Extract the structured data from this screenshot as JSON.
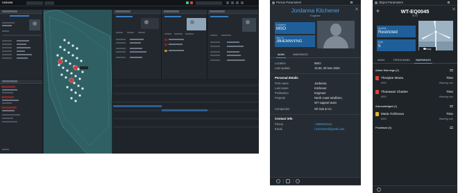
{
  "dashboard": {
    "logo": "VISION"
  },
  "person_panel": {
    "window_title": "Person Parameters",
    "name": "Jordanna Kitchener",
    "role": "Engineer",
    "location_label": "Location",
    "location_value": "MSO",
    "site_id_label": "Site ID",
    "site_id_value": "J8HENNVFNG",
    "tabs": [
      "MAIN",
      "WARNINGS"
    ],
    "active_tab": "MAIN",
    "status_rows": [
      {
        "k": "Location",
        "v": "MSO"
      },
      {
        "k": "Last update",
        "v": "15:30, 28 Nov 2020"
      }
    ],
    "personal_title": "Personal details",
    "personal_rows": [
      {
        "k": "First name",
        "v": "Jordanna"
      },
      {
        "k": "Last name",
        "v": "Kitchener"
      },
      {
        "k": "Profession",
        "v": "Engineer"
      },
      {
        "k": "Projects",
        "v": "North coast windfarm,"
      },
      {
        "k": "",
        "v": "WT support team"
      },
      {
        "k": "Companies",
        "v": "Oil Gas & Co."
      }
    ],
    "contact_title": "Contact info",
    "contact_rows": [
      {
        "k": "Phone",
        "v": "+3600023112"
      },
      {
        "k": "Email",
        "v": "f.Kitchener@gmail.com"
      }
    ],
    "footer_icons": [
      "crosshair-icon",
      "link-icon",
      "refresh-icon"
    ]
  },
  "object_panel": {
    "window_title": "Object Parameters",
    "name": "WT-EQ0045",
    "subtitle": "WTG",
    "access_label": "Access",
    "access_value": "Restricted",
    "poi_label": "PoB",
    "poi_value": "5",
    "flag_country": "Norway",
    "tabs": [
      "MAIN",
      "PERSONNEL",
      "WARNINGS"
    ],
    "active_tab": "WARNINGS",
    "active_warnings_title": "Active Warnings (2)",
    "warnings": [
      {
        "name": "Thenjiwe Msutu",
        "time_label": "Time",
        "company": "MSO",
        "rule": "Warning rule",
        "color": "#d9443b"
      },
      {
        "name": "Thanawan Chadee",
        "time_label": "Time",
        "company": "MSO",
        "rule": "Warning rule",
        "color": "#d9443b"
      }
    ],
    "acknowledged_title": "Acknowledged (1)",
    "acknowledged": [
      {
        "name": "Maria Trofimova",
        "time_label": "Time",
        "company": "MSO",
        "rule": "Warning rule",
        "color": "#e3b32a"
      }
    ],
    "prioritised_title": "Prioritised (0)"
  }
}
